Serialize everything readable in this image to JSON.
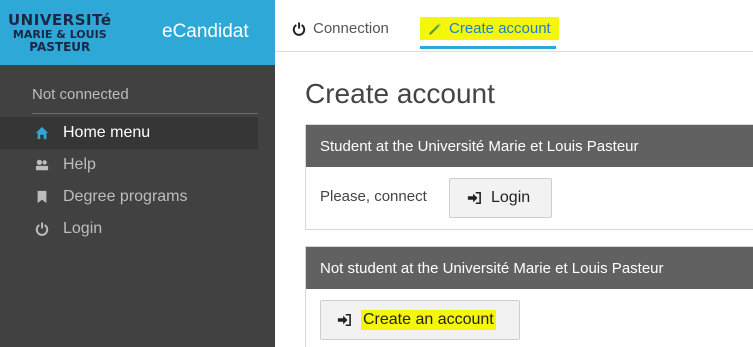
{
  "brand": {
    "logo_line1": "UNIVERSITé",
    "logo_line2": "MARIE & LOUIS",
    "logo_line3": "PASTEUR",
    "app_name": "eCandidat",
    "color": "#2ea8d6"
  },
  "sidebar": {
    "status": "Not connected",
    "items": [
      {
        "label": "Home menu",
        "icon": "home-icon",
        "active": true
      },
      {
        "label": "Help",
        "icon": "help-icon",
        "active": false
      },
      {
        "label": "Degree programs",
        "icon": "bookmark-icon",
        "active": false
      },
      {
        "label": "Login",
        "icon": "power-icon",
        "active": false
      }
    ]
  },
  "topbar": {
    "tabs": [
      {
        "label": "Connection",
        "icon": "power-icon"
      },
      {
        "label": "Create account",
        "icon": "magic-wand-icon",
        "active": true
      }
    ],
    "highlight_color": "#f4f70a"
  },
  "main": {
    "title": "Create account",
    "student_panel": {
      "header": "Student at the Université Marie et Louis Pasteur",
      "prompt": "Please, connect",
      "login_button": "Login"
    },
    "non_student_panel": {
      "header": "Not student at the Université Marie et Louis Pasteur",
      "create_button": "Create an account"
    }
  }
}
